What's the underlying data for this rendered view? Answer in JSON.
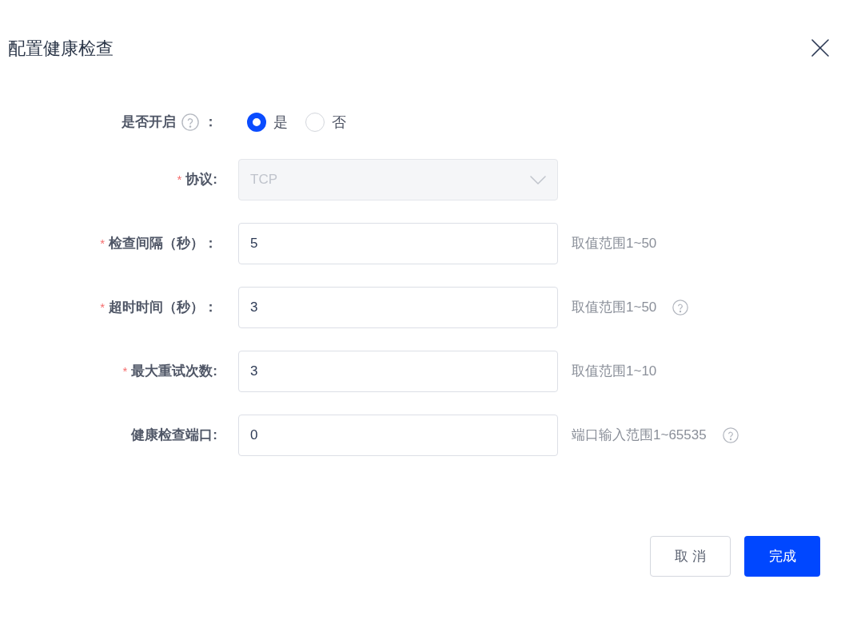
{
  "dialog": {
    "title": "配置健康检查"
  },
  "form": {
    "fields": [
      {
        "kind": "radio",
        "label": "是否开启",
        "label_help": true,
        "label_suffix": "：",
        "options": [
          {
            "label": "是",
            "selected": true
          },
          {
            "label": "否",
            "selected": false
          }
        ]
      },
      {
        "kind": "select",
        "required_mark": "*",
        "label": "协议:",
        "value": "TCP",
        "disabled": true
      },
      {
        "kind": "input",
        "required_mark": "*",
        "label": "检查间隔（秒）：",
        "value": "5",
        "hint": "取值范围1~50"
      },
      {
        "kind": "input",
        "required_mark": "*",
        "label": "超时时间（秒）：",
        "value": "3",
        "hint": "取值范围1~50",
        "hint_help": true
      },
      {
        "kind": "input",
        "required_mark": "*",
        "label": "最大重试次数:",
        "value": "3",
        "hint": "取值范围1~10"
      },
      {
        "kind": "input",
        "label": "健康检查端口:",
        "value": "0",
        "hint": "端口输入范围1~65535",
        "hint_help": true
      }
    ]
  },
  "buttons": [
    {
      "label": "取 消",
      "kind": "default"
    },
    {
      "label": "完成",
      "kind": "primary"
    }
  ]
}
